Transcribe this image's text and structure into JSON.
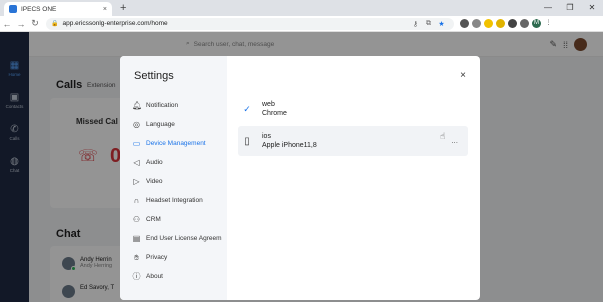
{
  "browser": {
    "tab_title": "IPECS ONE",
    "tab_close": "×",
    "new_tab": "+",
    "win_controls": [
      "—",
      "❐",
      "✕"
    ],
    "back": "←",
    "forward": "→",
    "reload": "↻",
    "url": "app.ericssonlg-enterprise.com/home",
    "profile_initial": "M"
  },
  "sidebar": {
    "items": [
      {
        "label": "Home",
        "icon": "grid-icon"
      },
      {
        "label": "Contacts",
        "icon": "contacts-icon"
      },
      {
        "label": "Calls",
        "icon": "phone-icon"
      },
      {
        "label": "Chat",
        "icon": "chat-icon"
      }
    ]
  },
  "header": {
    "search_placeholder": "Search user, chat, message"
  },
  "calls": {
    "title": "Calls",
    "ext_label": "Extension",
    "missed_label": "Missed Cal",
    "missed_count": "0"
  },
  "chat": {
    "title": "Chat",
    "rows": [
      {
        "name": "Andy Herrin",
        "sub": "Andy Herring"
      },
      {
        "name": "Ed Savory, T",
        "sub": ""
      }
    ]
  },
  "settings": {
    "title": "Settings",
    "close": "×",
    "menu": [
      {
        "label": "Notification",
        "icon": "bell-icon",
        "active": false
      },
      {
        "label": "Language",
        "icon": "globe-icon",
        "active": false
      },
      {
        "label": "Device Management",
        "icon": "device-icon",
        "active": true
      },
      {
        "label": "Audio",
        "icon": "speaker-icon",
        "active": false
      },
      {
        "label": "Video",
        "icon": "video-icon",
        "active": false
      },
      {
        "label": "Headset Integration",
        "icon": "headset-icon",
        "active": false
      },
      {
        "label": "CRM",
        "icon": "person-icon",
        "active": false
      },
      {
        "label": "End User License Agreem",
        "icon": "document-icon",
        "active": false
      },
      {
        "label": "Privacy",
        "icon": "hand-icon",
        "active": false
      },
      {
        "label": "About",
        "icon": "info-icon",
        "active": false
      }
    ],
    "devices": [
      {
        "name": "web",
        "detail": "Chrome",
        "current": true
      },
      {
        "name": "ios",
        "detail": "Apple iPhone11,8",
        "current": false
      }
    ],
    "more": "..."
  },
  "colors": {
    "sidebar": "#1f2a44",
    "accent": "#1a73e8",
    "missed": "#d9343c"
  }
}
